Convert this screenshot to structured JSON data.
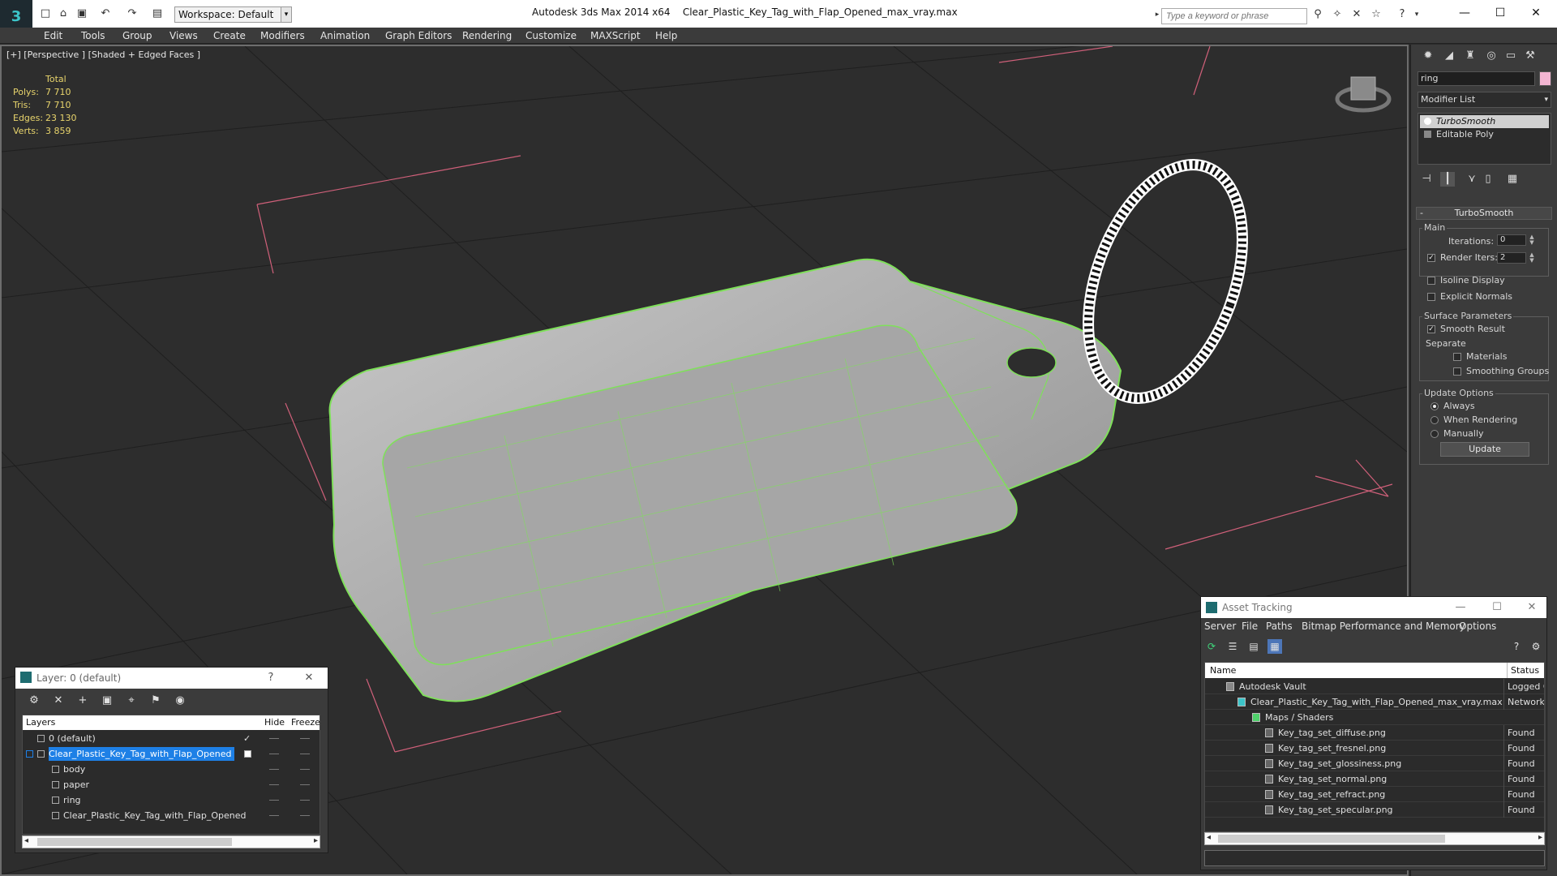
{
  "app": {
    "title": "Autodesk 3ds Max  2014 x64",
    "file": "Clear_Plastic_Key_Tag_with_Flap_Opened_max_vray.max",
    "workspace": "Workspace: Default",
    "search_placeholder": "Type a keyword or phrase"
  },
  "menu": [
    "Edit",
    "Tools",
    "Group",
    "Views",
    "Create",
    "Modifiers",
    "Animation",
    "Graph Editors",
    "Rendering",
    "Customize",
    "MAXScript",
    "Help"
  ],
  "viewport": {
    "label": "[+] [Perspective ] [Shaded + Edged Faces ]",
    "stats_header": "Total",
    "stats": [
      {
        "label": "Polys:",
        "value": "7 710"
      },
      {
        "label": "Tris:",
        "value": "7 710"
      },
      {
        "label": "Edges:",
        "value": "23 130"
      },
      {
        "label": "Verts:",
        "value": "3 859"
      }
    ]
  },
  "command_panel": {
    "object_name": "ring",
    "object_color": "#f3b5d2",
    "modifier_list": "Modifier List",
    "stack": [
      "TurboSmooth",
      "Editable Poly"
    ],
    "rollout_title": "TurboSmooth",
    "main_group": "Main",
    "iterations_label": "Iterations:",
    "iterations_value": "0",
    "render_iters_label": "Render Iters:",
    "render_iters_value": "2",
    "isoline_display": "Isoline Display",
    "explicit_normals": "Explicit Normals",
    "surface_group": "Surface Parameters",
    "smooth_result": "Smooth Result",
    "separate": "Separate",
    "materials": "Materials",
    "smoothing_groups": "Smoothing Groups",
    "update_group": "Update Options",
    "always": "Always",
    "when_rendering": "When Rendering",
    "manually": "Manually",
    "update_button": "Update"
  },
  "layer_window": {
    "title": "Layer: 0 (default)",
    "help": "?",
    "col_layers": "Layers",
    "col_hide": "Hide",
    "col_freeze": "Freeze",
    "rows": [
      {
        "name": "0 (default)",
        "indent": 0,
        "selected": false
      },
      {
        "name": "Clear_Plastic_Key_Tag_with_Flap_Opened",
        "indent": 0,
        "selected": true
      },
      {
        "name": "body",
        "indent": 1,
        "selected": false
      },
      {
        "name": "paper",
        "indent": 1,
        "selected": false
      },
      {
        "name": "ring",
        "indent": 1,
        "selected": false
      },
      {
        "name": "Clear_Plastic_Key_Tag_with_Flap_Opened",
        "indent": 1,
        "selected": false
      }
    ]
  },
  "asset_tracking": {
    "title": "Asset Tracking",
    "menu": [
      "Server",
      "File",
      "Paths",
      "Bitmap Performance and Memory",
      "Options"
    ],
    "col_name": "Name",
    "col_status": "Status",
    "rows": [
      {
        "name": "Autodesk Vault",
        "status": "Logged Out",
        "level": 1
      },
      {
        "name": "Clear_Plastic_Key_Tag_with_Flap_Opened_max_vray.max",
        "status": "Network",
        "level": 2
      },
      {
        "name": "Maps / Shaders",
        "status": "",
        "level": 3
      },
      {
        "name": "Key_tag_set_diffuse.png",
        "status": "Found",
        "level": 4
      },
      {
        "name": "Key_tag_set_fresnel.png",
        "status": "Found",
        "level": 4
      },
      {
        "name": "Key_tag_set_glossiness.png",
        "status": "Found",
        "level": 4
      },
      {
        "name": "Key_tag_set_normal.png",
        "status": "Found",
        "level": 4
      },
      {
        "name": "Key_tag_set_refract.png",
        "status": "Found",
        "level": 4
      },
      {
        "name": "Key_tag_set_specular.png",
        "status": "Found",
        "level": 4
      }
    ]
  }
}
